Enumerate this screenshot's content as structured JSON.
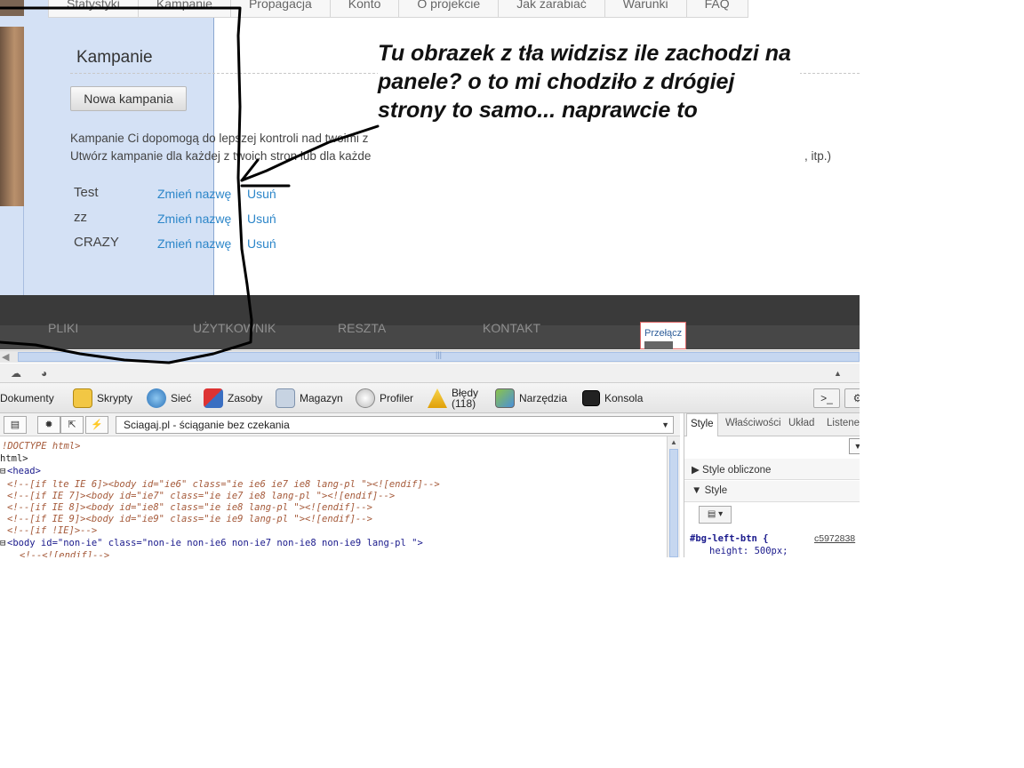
{
  "top_nav": [
    "Statystyki",
    "Kampanie",
    "Propagacja",
    "Konto",
    "O projekcie",
    "Jak zarabiać",
    "Warunki",
    "FAQ"
  ],
  "page": {
    "title": "Kampanie",
    "new_campaign_button": "Nowa kampania",
    "description_line1": "Kampanie Ci dopomogą do lepszej kontroli nad twoimi z",
    "description_line2": "Utwórz kampanie dla każdej z twoich stron lub dla każde",
    "description_tail": ", itp.)",
    "campaigns": [
      {
        "name": "Test",
        "rename": "Zmień nazwę",
        "remove": "Usuń"
      },
      {
        "name": "zz",
        "rename": "Zmień nazwę",
        "remove": "Usuń"
      },
      {
        "name": "CRAZY",
        "rename": "Zmień nazwę",
        "remove": "Usuń"
      }
    ]
  },
  "footer_nav": [
    "PLIKI",
    "UŻYTKOWNIK",
    "RESZTA",
    "KONTAKT"
  ],
  "switch_label": "Przełącz",
  "annotation": "Tu obrazek z tła widzisz ile zachodzi na panele? o to mi chodziło  z drógiej strony to samo... naprawcie to",
  "devtools": {
    "tabs": [
      {
        "label": "Dokumenty",
        "icon": "documents-icon"
      },
      {
        "label": "Skrypty",
        "icon": "scripts-icon"
      },
      {
        "label": "Sieć",
        "icon": "network-icon"
      },
      {
        "label": "Zasoby",
        "icon": "resources-icon"
      },
      {
        "label": "Magazyn",
        "icon": "storage-icon"
      },
      {
        "label": "Profiler",
        "icon": "profiler-icon"
      },
      {
        "label": "Błędy",
        "sub": "(118)",
        "icon": "errors-icon"
      },
      {
        "label": "Narzędzia",
        "icon": "tools-icon"
      },
      {
        "label": "Konsola",
        "icon": "console-icon"
      }
    ],
    "page_select": "Sciagaj.pl - ściąganie bez czekania",
    "source_lines": [
      "!DOCTYPE html>",
      "html>",
      "<head>",
      "<!--[if lte IE 6]><body id=\"ie6\" class=\"ie ie6 ie7 ie8 lang-pl \"><![endif]-->",
      "<!--[if IE 7]><body id=\"ie7\" class=\"ie ie7 ie8 lang-pl \"><![endif]-->",
      "<!--[if IE 8]><body id=\"ie8\" class=\"ie ie8 lang-pl \"><![endif]-->",
      "<!--[if IE 9]><body id=\"ie9\" class=\"ie ie9 lang-pl \"><![endif]-->",
      "<!--[if !IE]>-->",
      "<body id=\"non-ie\" class=\"non-ie non-ie6 non-ie7 non-ie8 non-ie9 lang-pl \">",
      "<!--<![endif]-->"
    ],
    "side_tabs": [
      "Style",
      "Właściwości",
      "Układ",
      "Listener"
    ],
    "side_sections": [
      "Style obliczone",
      "Style"
    ],
    "css_selector": "#bg-left-btn {",
    "css_source": "c5972838",
    "css_property": "height: 500px;"
  }
}
